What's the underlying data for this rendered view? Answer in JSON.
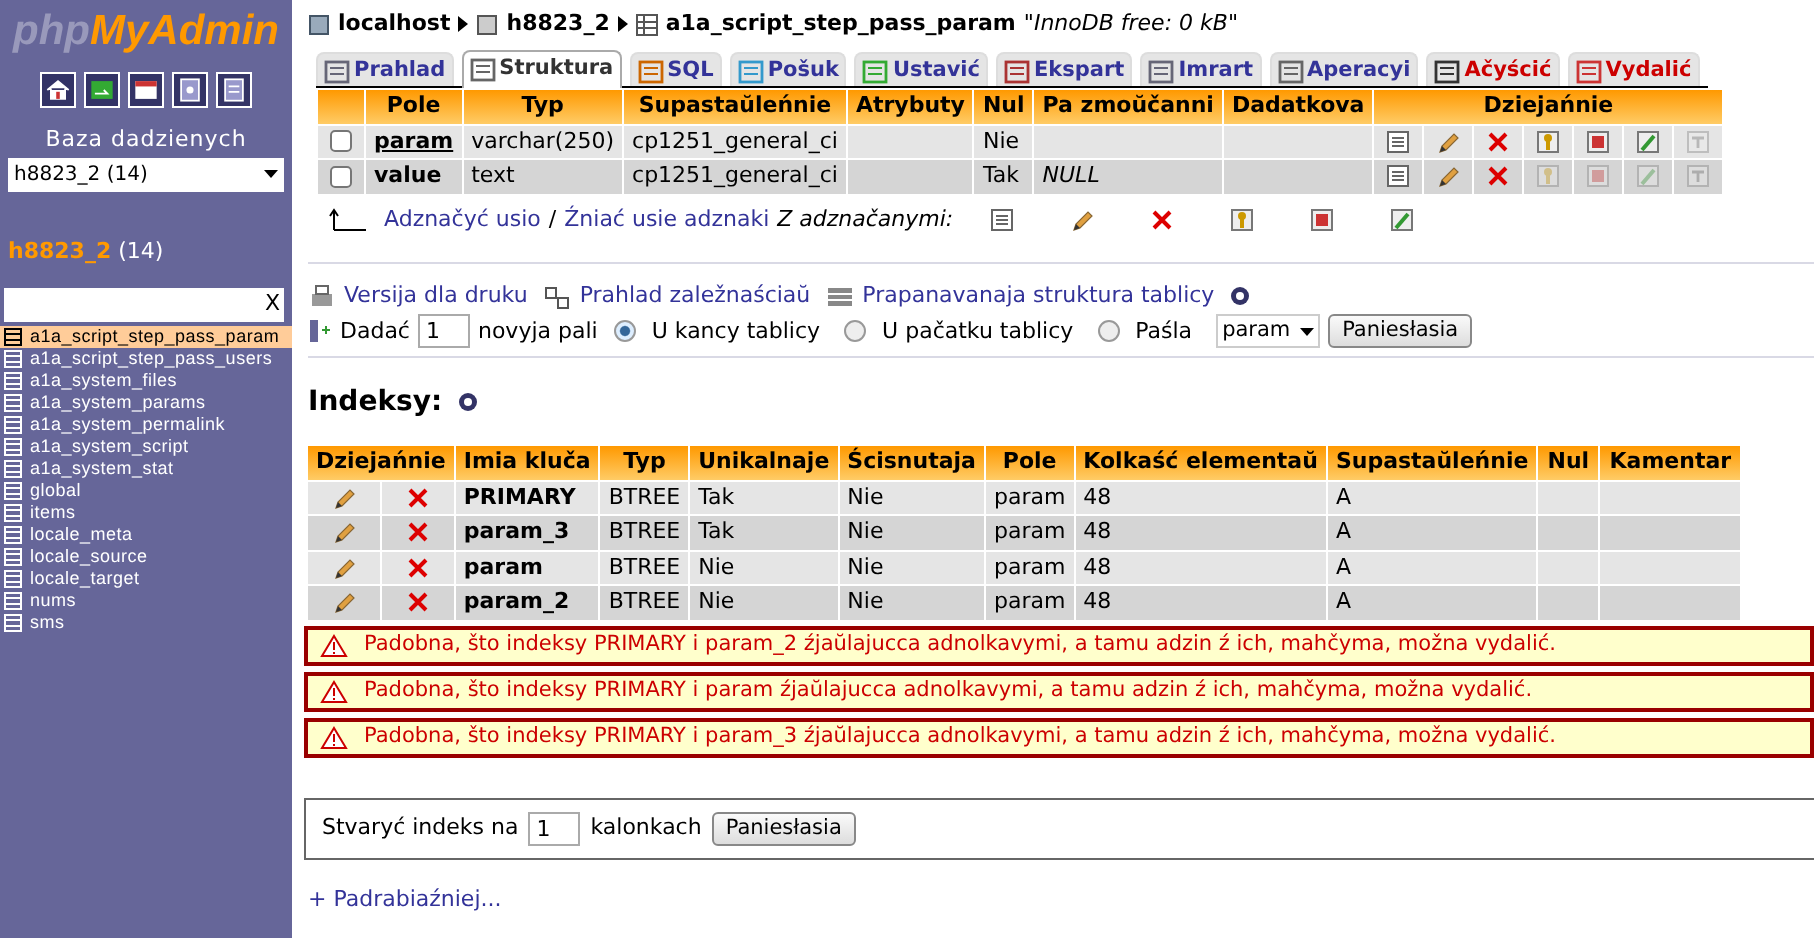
{
  "sidebar": {
    "logo_prefix": "php",
    "logo": "MyAdmin",
    "db_label": "Baza dadzienych",
    "db_select": "h8823_2 (14)",
    "db_name": "h8823_2",
    "db_count": "(14)",
    "filter_clear": "X",
    "tables": [
      {
        "name": "a1a_script_step_pass_param",
        "selected": true
      },
      {
        "name": "a1a_script_step_pass_users",
        "selected": false
      },
      {
        "name": "a1a_system_files",
        "selected": false
      },
      {
        "name": "a1a_system_params",
        "selected": false
      },
      {
        "name": "a1a_system_permalink",
        "selected": false
      },
      {
        "name": "a1a_system_script",
        "selected": false
      },
      {
        "name": "a1a_system_stat",
        "selected": false
      },
      {
        "name": "global",
        "selected": false
      },
      {
        "name": "items",
        "selected": false
      },
      {
        "name": "locale_meta",
        "selected": false
      },
      {
        "name": "locale_source",
        "selected": false
      },
      {
        "name": "locale_target",
        "selected": false
      },
      {
        "name": "nums",
        "selected": false
      },
      {
        "name": "sms",
        "selected": false
      }
    ]
  },
  "breadcrumb": {
    "server": "localhost",
    "database": "h8823_2",
    "table": "a1a_script_step_pass_param",
    "comment": "\"InnoDB free: 0 kB\""
  },
  "tabs": [
    {
      "label": "Prahlad",
      "selected": false,
      "kind": "normal"
    },
    {
      "label": "Struktura",
      "selected": true,
      "kind": "normal"
    },
    {
      "label": "SQL",
      "selected": false,
      "kind": "normal"
    },
    {
      "label": "Pošuk",
      "selected": false,
      "kind": "normal"
    },
    {
      "label": "Ustavić",
      "selected": false,
      "kind": "normal"
    },
    {
      "label": "Ekspart",
      "selected": false,
      "kind": "normal"
    },
    {
      "label": "Imrart",
      "selected": false,
      "kind": "normal"
    },
    {
      "label": "Aperacyi",
      "selected": false,
      "kind": "normal"
    },
    {
      "label": "Ačyścić",
      "selected": false,
      "kind": "danger"
    },
    {
      "label": "Vydalić",
      "selected": false,
      "kind": "danger"
    }
  ],
  "fields": {
    "columns": [
      "Pole",
      "Typ",
      "Supastaŭleńnie",
      "Atrybuty",
      "Nul",
      "Pa zmoŭčanni",
      "Dadatkova",
      "Dziejańnie"
    ],
    "rows": [
      {
        "checked": false,
        "name": "param",
        "primary": true,
        "type": "varchar(250)",
        "collation": "cp1251_general_ci",
        "null": "Nie",
        "actions": [
          {
            "disabled": false
          },
          {
            "disabled": false
          },
          {
            "disabled": false
          },
          {
            "disabled": false
          },
          {
            "disabled": false
          },
          {
            "disabled": false
          },
          {
            "disabled": true
          }
        ]
      },
      {
        "checked": false,
        "name": "value",
        "primary": false,
        "type": "text",
        "collation": "cp1251_general_ci",
        "null": "Tak",
        "default": "NULL",
        "actions": [
          {
            "disabled": false
          },
          {
            "disabled": false
          },
          {
            "disabled": false
          },
          {
            "disabled": true
          },
          {
            "disabled": true
          },
          {
            "disabled": true
          },
          {
            "disabled": true
          }
        ]
      }
    ],
    "check_all": "Adznačyć usio",
    "separator": "/",
    "uncheck_all": "Źniać usie adznaki",
    "with_selected": "Z adznačanymi:"
  },
  "links": [
    "Versija dla druku",
    "Prahlad zaležnaściaŭ",
    "Prapanavanaja struktura tablicy"
  ],
  "add_fields": {
    "label": "Dadać",
    "count": "1",
    "suffix": "novyja pali",
    "options": [
      {
        "label": "U kancy tablicy",
        "selected": true
      },
      {
        "label": "U pačatku tablicy",
        "selected": false
      },
      {
        "label": "Paśla",
        "selected": false
      }
    ],
    "after_field": "param",
    "button": "Paniesłasia"
  },
  "indexes": {
    "title": "Indeksy:",
    "columns": [
      "Dziejańnie",
      "Imia kluča",
      "Typ",
      "Unikalnaje",
      "Ścisnutaja",
      "Pole",
      "Kolkaść elementaŭ",
      "Supastaŭleńnie",
      "Nul",
      "Kamentar"
    ],
    "rows": [
      {
        "key": "PRIMARY",
        "type": "BTREE",
        "unique": "Tak",
        "packed": "Nie",
        "field": "param",
        "cardinality": "48",
        "collation": "A"
      },
      {
        "key": "param_3",
        "type": "BTREE",
        "unique": "Tak",
        "packed": "Nie",
        "field": "param",
        "cardinality": "48",
        "collation": "A"
      },
      {
        "key": "param",
        "type": "BTREE",
        "unique": "Nie",
        "packed": "Nie",
        "field": "param",
        "cardinality": "48",
        "collation": "A"
      },
      {
        "key": "param_2",
        "type": "BTREE",
        "unique": "Nie",
        "packed": "Nie",
        "field": "param",
        "cardinality": "48",
        "collation": "A"
      }
    ]
  },
  "warnings": [
    "Padobna, što indeksy PRIMARY i param_2 źjaŭlajucca adnolkavymi, a tamu adzin ź ich, mahčyma, možna vydalić.",
    "Padobna, što indeksy PRIMARY i param źjaŭlajucca adnolkavymi, a tamu adzin ź ich, mahčyma, možna vydalić.",
    "Padobna, što indeksy PRIMARY i param_3 źjaŭlajucca adnolkavymi, a tamu adzin ź ich, mahčyma, možna vydalić."
  ],
  "create_index": {
    "label": "Stvaryć indeks na",
    "count": "1",
    "suffix": "kalonkach",
    "button": "Paniesłasia"
  },
  "more_link": "+ Padrabiaźniej..."
}
